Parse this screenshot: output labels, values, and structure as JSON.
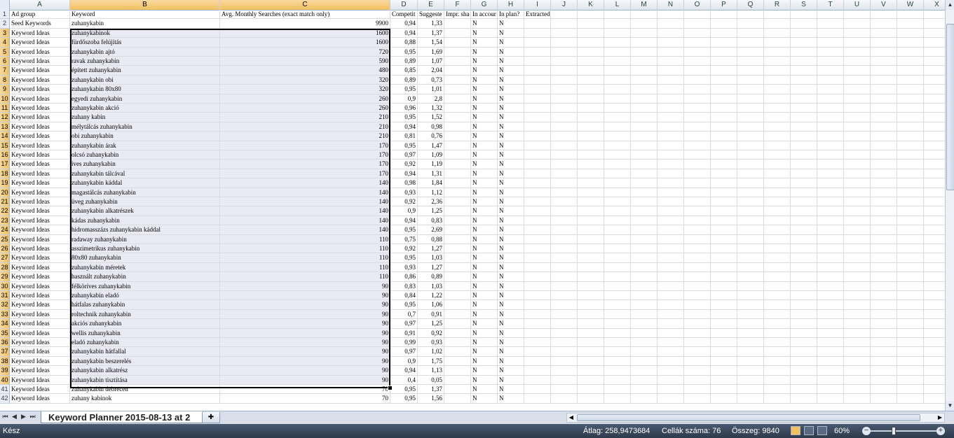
{
  "columns": [
    "A",
    "B",
    "C",
    "D",
    "E",
    "F",
    "G",
    "H",
    "I",
    "J",
    "K",
    "L",
    "M",
    "N",
    "O",
    "P",
    "Q",
    "R",
    "S",
    "T",
    "U",
    "V",
    "W",
    "X"
  ],
  "rows": [
    {
      "n": "1",
      "a": "Ad group",
      "b": "Keyword",
      "c": "Avg. Monthly Searches (exact match only)",
      "d": "Competit",
      "e": "Suggeste",
      "f": "Impr. sha",
      "g": "In accour",
      "h": "In plan?",
      "i": "Extracted From"
    },
    {
      "n": "2",
      "a": "Seed Keywords",
      "b": "zuhanykabin",
      "c": "9900",
      "d": "0,94",
      "e": "1,33",
      "g": "N",
      "h": "N"
    },
    {
      "n": "3",
      "a": "Keyword Ideas",
      "b": "zuhanykabinok",
      "c": "1600",
      "d": "0,94",
      "e": "1,37",
      "g": "N",
      "h": "N"
    },
    {
      "n": "4",
      "a": "Keyword Ideas",
      "b": "fürdőszoba felújítás",
      "c": "1600",
      "d": "0,88",
      "e": "1,54",
      "g": "N",
      "h": "N"
    },
    {
      "n": "5",
      "a": "Keyword Ideas",
      "b": "zuhanykabin ajtó",
      "c": "720",
      "d": "0,95",
      "e": "1,69",
      "g": "N",
      "h": "N"
    },
    {
      "n": "6",
      "a": "Keyword Ideas",
      "b": "ravak zuhanykabin",
      "c": "590",
      "d": "0,89",
      "e": "1,07",
      "g": "N",
      "h": "N"
    },
    {
      "n": "7",
      "a": "Keyword Ideas",
      "b": "épített zuhanykabin",
      "c": "480",
      "d": "0,85",
      "e": "2,04",
      "g": "N",
      "h": "N"
    },
    {
      "n": "8",
      "a": "Keyword Ideas",
      "b": "zuhanykabin obi",
      "c": "320",
      "d": "0,89",
      "e": "0,73",
      "g": "N",
      "h": "N"
    },
    {
      "n": "9",
      "a": "Keyword Ideas",
      "b": "zuhanykabin 80x80",
      "c": "320",
      "d": "0,95",
      "e": "1,01",
      "g": "N",
      "h": "N"
    },
    {
      "n": "10",
      "a": "Keyword Ideas",
      "b": "egyedi zuhanykabin",
      "c": "260",
      "d": "0,9",
      "e": "2,8",
      "g": "N",
      "h": "N"
    },
    {
      "n": "11",
      "a": "Keyword Ideas",
      "b": "zuhanykabin akció",
      "c": "260",
      "d": "0,96",
      "e": "1,32",
      "g": "N",
      "h": "N"
    },
    {
      "n": "12",
      "a": "Keyword Ideas",
      "b": "zuhany kabin",
      "c": "210",
      "d": "0,95",
      "e": "1,52",
      "g": "N",
      "h": "N"
    },
    {
      "n": "13",
      "a": "Keyword Ideas",
      "b": "mélytálcás zuhanykabin",
      "c": "210",
      "d": "0,94",
      "e": "0,98",
      "g": "N",
      "h": "N"
    },
    {
      "n": "14",
      "a": "Keyword Ideas",
      "b": "obi zuhanykabin",
      "c": "210",
      "d": "0,81",
      "e": "0,76",
      "g": "N",
      "h": "N"
    },
    {
      "n": "15",
      "a": "Keyword Ideas",
      "b": "zuhanykabin árak",
      "c": "170",
      "d": "0,95",
      "e": "1,47",
      "g": "N",
      "h": "N"
    },
    {
      "n": "16",
      "a": "Keyword Ideas",
      "b": "olcsó zuhanykabin",
      "c": "170",
      "d": "0,97",
      "e": "1,09",
      "g": "N",
      "h": "N"
    },
    {
      "n": "17",
      "a": "Keyword Ideas",
      "b": "íves zuhanykabin",
      "c": "170",
      "d": "0,92",
      "e": "1,19",
      "g": "N",
      "h": "N"
    },
    {
      "n": "18",
      "a": "Keyword Ideas",
      "b": "zuhanykabin tálcával",
      "c": "170",
      "d": "0,94",
      "e": "1,31",
      "g": "N",
      "h": "N"
    },
    {
      "n": "19",
      "a": "Keyword Ideas",
      "b": "zuhanykabin káddal",
      "c": "140",
      "d": "0,98",
      "e": "1,84",
      "g": "N",
      "h": "N"
    },
    {
      "n": "20",
      "a": "Keyword Ideas",
      "b": "magastálcás zuhanykabin",
      "c": "140",
      "d": "0,93",
      "e": "1,12",
      "g": "N",
      "h": "N"
    },
    {
      "n": "21",
      "a": "Keyword Ideas",
      "b": "üveg zuhanykabin",
      "c": "140",
      "d": "0,92",
      "e": "2,36",
      "g": "N",
      "h": "N"
    },
    {
      "n": "22",
      "a": "Keyword Ideas",
      "b": "zuhanykabin alkatrészek",
      "c": "140",
      "d": "0,9",
      "e": "1,25",
      "g": "N",
      "h": "N"
    },
    {
      "n": "23",
      "a": "Keyword Ideas",
      "b": "kádas zuhanykabin",
      "c": "140",
      "d": "0,94",
      "e": "0,83",
      "g": "N",
      "h": "N"
    },
    {
      "n": "24",
      "a": "Keyword Ideas",
      "b": "hidromasszázs zuhanykabin káddal",
      "c": "140",
      "d": "0,95",
      "e": "2,69",
      "g": "N",
      "h": "N"
    },
    {
      "n": "25",
      "a": "Keyword Ideas",
      "b": "radaway zuhanykabin",
      "c": "110",
      "d": "0,75",
      "e": "0,88",
      "g": "N",
      "h": "N"
    },
    {
      "n": "26",
      "a": "Keyword Ideas",
      "b": "asszimetrikus zuhanykabin",
      "c": "110",
      "d": "0,92",
      "e": "1,27",
      "g": "N",
      "h": "N"
    },
    {
      "n": "27",
      "a": "Keyword Ideas",
      "b": "80x80 zuhanykabin",
      "c": "110",
      "d": "0,95",
      "e": "1,03",
      "g": "N",
      "h": "N"
    },
    {
      "n": "28",
      "a": "Keyword Ideas",
      "b": "zuhanykabin méretek",
      "c": "110",
      "d": "0,93",
      "e": "1,27",
      "g": "N",
      "h": "N"
    },
    {
      "n": "29",
      "a": "Keyword Ideas",
      "b": "használt zuhanykabin",
      "c": "110",
      "d": "0,86",
      "e": "0,89",
      "g": "N",
      "h": "N"
    },
    {
      "n": "30",
      "a": "Keyword Ideas",
      "b": "félköríves zuhanykabin",
      "c": "90",
      "d": "0,83",
      "e": "1,03",
      "g": "N",
      "h": "N"
    },
    {
      "n": "31",
      "a": "Keyword Ideas",
      "b": "zuhanykabin eladó",
      "c": "90",
      "d": "0,84",
      "e": "1,22",
      "g": "N",
      "h": "N"
    },
    {
      "n": "32",
      "a": "Keyword Ideas",
      "b": "hátfalas zuhanykabin",
      "c": "90",
      "d": "0,95",
      "e": "1,06",
      "g": "N",
      "h": "N"
    },
    {
      "n": "33",
      "a": "Keyword Ideas",
      "b": "roltechnik zuhanykabin",
      "c": "90",
      "d": "0,7",
      "e": "0,91",
      "g": "N",
      "h": "N"
    },
    {
      "n": "34",
      "a": "Keyword Ideas",
      "b": "akciós zuhanykabin",
      "c": "90",
      "d": "0,97",
      "e": "1,25",
      "g": "N",
      "h": "N"
    },
    {
      "n": "35",
      "a": "Keyword Ideas",
      "b": "wellis zuhanykabin",
      "c": "90",
      "d": "0,91",
      "e": "0,92",
      "g": "N",
      "h": "N"
    },
    {
      "n": "36",
      "a": "Keyword Ideas",
      "b": "eladó zuhanykabin",
      "c": "90",
      "d": "0,99",
      "e": "0,93",
      "g": "N",
      "h": "N"
    },
    {
      "n": "37",
      "a": "Keyword Ideas",
      "b": "zuhanykabin hátfallal",
      "c": "90",
      "d": "0,97",
      "e": "1,02",
      "g": "N",
      "h": "N"
    },
    {
      "n": "38",
      "a": "Keyword Ideas",
      "b": "zuhanykabin beszerelés",
      "c": "90",
      "d": "0,9",
      "e": "1,75",
      "g": "N",
      "h": "N"
    },
    {
      "n": "39",
      "a": "Keyword Ideas",
      "b": "zuhanykabin alkatrész",
      "c": "90",
      "d": "0,94",
      "e": "1,13",
      "g": "N",
      "h": "N"
    },
    {
      "n": "40",
      "a": "Keyword Ideas",
      "b": "zuhanykabin tisztítása",
      "c": "90",
      "d": "0,4",
      "e": "0,05",
      "g": "N",
      "h": "N"
    },
    {
      "n": "41",
      "a": "Keyword Ideas",
      "b": "zuhanykabin debrecen",
      "c": "70",
      "d": "0,95",
      "e": "1,37",
      "g": "N",
      "h": "N"
    },
    {
      "n": "42",
      "a": "Keyword Ideas",
      "b": "zuhany kabinok",
      "c": "70",
      "d": "0,95",
      "e": "1,56",
      "g": "N",
      "h": "N"
    }
  ],
  "sheet_tab": "Keyword Planner 2015-08-13 at 2",
  "status": {
    "ready": "Kész",
    "average": "Átlag: 258,9473684",
    "count": "Cellák száma: 76",
    "sum": "Összeg: 9840",
    "zoom": "60%"
  },
  "colors": {
    "selection_header": "#f1c15f",
    "status_bar": "#3a4659",
    "selection_fill": "#eaeaf4"
  }
}
